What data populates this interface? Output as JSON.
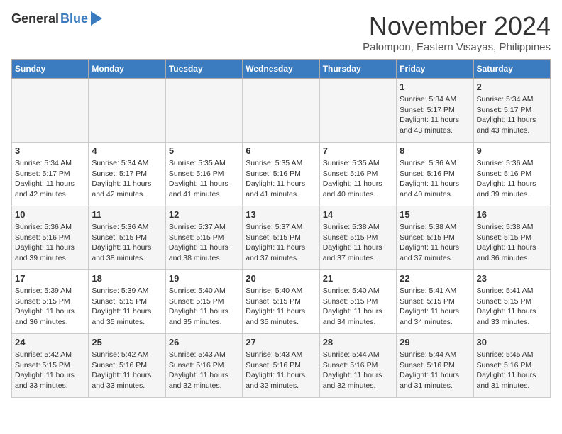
{
  "header": {
    "logo_general": "General",
    "logo_blue": "Blue",
    "month": "November 2024",
    "location": "Palompon, Eastern Visayas, Philippines"
  },
  "weekdays": [
    "Sunday",
    "Monday",
    "Tuesday",
    "Wednesday",
    "Thursday",
    "Friday",
    "Saturday"
  ],
  "weeks": [
    [
      {
        "day": "",
        "info": ""
      },
      {
        "day": "",
        "info": ""
      },
      {
        "day": "",
        "info": ""
      },
      {
        "day": "",
        "info": ""
      },
      {
        "day": "",
        "info": ""
      },
      {
        "day": "1",
        "info": "Sunrise: 5:34 AM\nSunset: 5:17 PM\nDaylight: 11 hours and 43 minutes."
      },
      {
        "day": "2",
        "info": "Sunrise: 5:34 AM\nSunset: 5:17 PM\nDaylight: 11 hours and 43 minutes."
      }
    ],
    [
      {
        "day": "3",
        "info": "Sunrise: 5:34 AM\nSunset: 5:17 PM\nDaylight: 11 hours and 42 minutes."
      },
      {
        "day": "4",
        "info": "Sunrise: 5:34 AM\nSunset: 5:17 PM\nDaylight: 11 hours and 42 minutes."
      },
      {
        "day": "5",
        "info": "Sunrise: 5:35 AM\nSunset: 5:16 PM\nDaylight: 11 hours and 41 minutes."
      },
      {
        "day": "6",
        "info": "Sunrise: 5:35 AM\nSunset: 5:16 PM\nDaylight: 11 hours and 41 minutes."
      },
      {
        "day": "7",
        "info": "Sunrise: 5:35 AM\nSunset: 5:16 PM\nDaylight: 11 hours and 40 minutes."
      },
      {
        "day": "8",
        "info": "Sunrise: 5:36 AM\nSunset: 5:16 PM\nDaylight: 11 hours and 40 minutes."
      },
      {
        "day": "9",
        "info": "Sunrise: 5:36 AM\nSunset: 5:16 PM\nDaylight: 11 hours and 39 minutes."
      }
    ],
    [
      {
        "day": "10",
        "info": "Sunrise: 5:36 AM\nSunset: 5:16 PM\nDaylight: 11 hours and 39 minutes."
      },
      {
        "day": "11",
        "info": "Sunrise: 5:36 AM\nSunset: 5:15 PM\nDaylight: 11 hours and 38 minutes."
      },
      {
        "day": "12",
        "info": "Sunrise: 5:37 AM\nSunset: 5:15 PM\nDaylight: 11 hours and 38 minutes."
      },
      {
        "day": "13",
        "info": "Sunrise: 5:37 AM\nSunset: 5:15 PM\nDaylight: 11 hours and 37 minutes."
      },
      {
        "day": "14",
        "info": "Sunrise: 5:38 AM\nSunset: 5:15 PM\nDaylight: 11 hours and 37 minutes."
      },
      {
        "day": "15",
        "info": "Sunrise: 5:38 AM\nSunset: 5:15 PM\nDaylight: 11 hours and 37 minutes."
      },
      {
        "day": "16",
        "info": "Sunrise: 5:38 AM\nSunset: 5:15 PM\nDaylight: 11 hours and 36 minutes."
      }
    ],
    [
      {
        "day": "17",
        "info": "Sunrise: 5:39 AM\nSunset: 5:15 PM\nDaylight: 11 hours and 36 minutes."
      },
      {
        "day": "18",
        "info": "Sunrise: 5:39 AM\nSunset: 5:15 PM\nDaylight: 11 hours and 35 minutes."
      },
      {
        "day": "19",
        "info": "Sunrise: 5:40 AM\nSunset: 5:15 PM\nDaylight: 11 hours and 35 minutes."
      },
      {
        "day": "20",
        "info": "Sunrise: 5:40 AM\nSunset: 5:15 PM\nDaylight: 11 hours and 35 minutes."
      },
      {
        "day": "21",
        "info": "Sunrise: 5:40 AM\nSunset: 5:15 PM\nDaylight: 11 hours and 34 minutes."
      },
      {
        "day": "22",
        "info": "Sunrise: 5:41 AM\nSunset: 5:15 PM\nDaylight: 11 hours and 34 minutes."
      },
      {
        "day": "23",
        "info": "Sunrise: 5:41 AM\nSunset: 5:15 PM\nDaylight: 11 hours and 33 minutes."
      }
    ],
    [
      {
        "day": "24",
        "info": "Sunrise: 5:42 AM\nSunset: 5:15 PM\nDaylight: 11 hours and 33 minutes."
      },
      {
        "day": "25",
        "info": "Sunrise: 5:42 AM\nSunset: 5:16 PM\nDaylight: 11 hours and 33 minutes."
      },
      {
        "day": "26",
        "info": "Sunrise: 5:43 AM\nSunset: 5:16 PM\nDaylight: 11 hours and 32 minutes."
      },
      {
        "day": "27",
        "info": "Sunrise: 5:43 AM\nSunset: 5:16 PM\nDaylight: 11 hours and 32 minutes."
      },
      {
        "day": "28",
        "info": "Sunrise: 5:44 AM\nSunset: 5:16 PM\nDaylight: 11 hours and 32 minutes."
      },
      {
        "day": "29",
        "info": "Sunrise: 5:44 AM\nSunset: 5:16 PM\nDaylight: 11 hours and 31 minutes."
      },
      {
        "day": "30",
        "info": "Sunrise: 5:45 AM\nSunset: 5:16 PM\nDaylight: 11 hours and 31 minutes."
      }
    ]
  ]
}
